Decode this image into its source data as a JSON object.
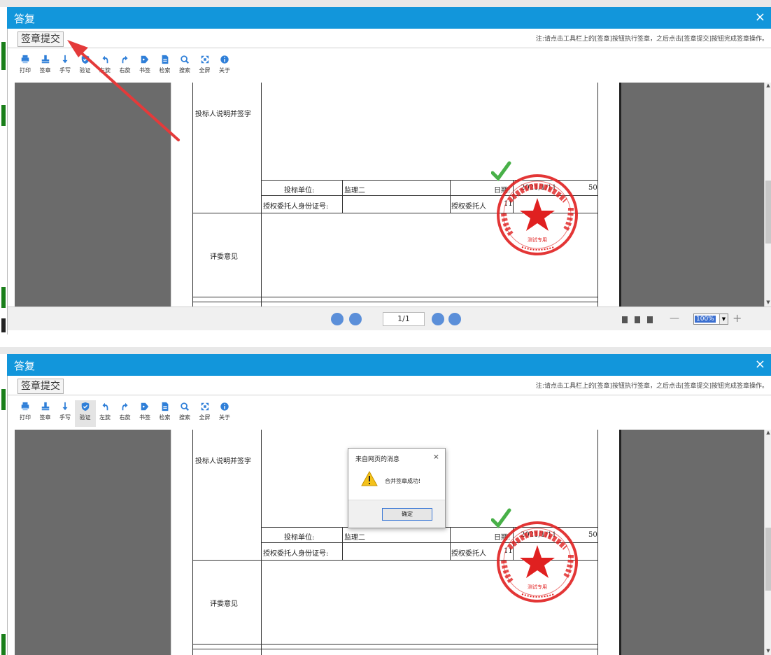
{
  "window": {
    "title": "答复",
    "close_glyph": "×",
    "submit_label": "签章提交",
    "hint": "注:请点击工具栏上的[签章]按钮执行签章，之后点击[签章提交]按钮完成签章操作。"
  },
  "toolbar": {
    "items": [
      {
        "label": "打印",
        "icon": "print-icon"
      },
      {
        "label": "签章",
        "icon": "stamp-icon"
      },
      {
        "label": "手写",
        "icon": "handwrite-icon"
      },
      {
        "label": "验证",
        "icon": "verify-icon"
      },
      {
        "label": "左旋",
        "icon": "rotate-left-icon"
      },
      {
        "label": "右旋",
        "icon": "rotate-right-icon"
      },
      {
        "label": "书签",
        "icon": "bookmark-icon"
      },
      {
        "label": "检索",
        "icon": "search-doc-icon"
      },
      {
        "label": "搜索",
        "icon": "search-icon"
      },
      {
        "label": "全屏",
        "icon": "fullscreen-icon"
      },
      {
        "label": "关于",
        "icon": "info-icon"
      }
    ]
  },
  "form": {
    "signature_label": "投标人说明并签字",
    "unit_label": "投标单位:",
    "unit_value": "监理二",
    "date_label": "日期:",
    "date_value": "2021/1/11",
    "time_suffix": "50",
    "id_label": "授权委托人身份证号:",
    "delegate_label": "授权委托人",
    "delegate_value": "11",
    "review_label": "评委意见"
  },
  "stamp": {
    "color": "#e02020",
    "check_color": "#48b048",
    "center_text": "测试专用"
  },
  "pager": {
    "page_indicator": "1/1",
    "zoom": "100%",
    "zoom_minus": "—",
    "zoom_plus": "+"
  },
  "dialog": {
    "title": "来自网页的消息",
    "close_glyph": "×",
    "message": "合并签章成功!",
    "ok_label": "确定"
  },
  "colors": {
    "titlebar": "#1296db",
    "viewer_grey": "#6b6b6b",
    "arrow_red": "#e43a3a"
  }
}
